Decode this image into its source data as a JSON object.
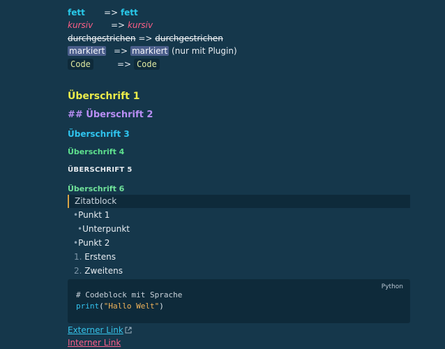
{
  "formatting": {
    "bold": {
      "source": "fett",
      "arrow": "=>",
      "result": "fett"
    },
    "italic": {
      "source": "kursiv",
      "arrow": "=>",
      "result": "kursiv"
    },
    "strike": {
      "source": "durchgestrichen",
      "arrow": "=>",
      "result": "durchgestrichen"
    },
    "mark": {
      "source": "markiert",
      "arrow": "=>",
      "result": "markiert",
      "note": "(nur mit Plugin)"
    },
    "code": {
      "source": "Code",
      "arrow": "=>",
      "result": "Code"
    }
  },
  "headings": {
    "h1": "Überschrift 1",
    "h2": "## Überschrift 2",
    "h3": "Überschrift 3",
    "h4": "Überschrift 4",
    "h5": "Überschrift 5",
    "h6": "Überschrift 6"
  },
  "quote": "Zitatblock",
  "bullets": {
    "item1": "Punkt 1",
    "sub1": "Unterpunkt",
    "item2": "Punkt 2",
    "marker": "•"
  },
  "ordered": {
    "n1": "1.",
    "item1": "Erstens",
    "n2": "2.",
    "item2": "Zweitens"
  },
  "codeblock": {
    "language": "Python",
    "line1": "# Codeblock mit Sprache",
    "fn": "print",
    "open": "(",
    "string": "\"Hallo Welt\"",
    "close": ")"
  },
  "links": {
    "external": "Externer Link",
    "internal": "Interner Link"
  },
  "colors": {
    "background": "#15374b",
    "bold": "#29c9ea",
    "italic": "#ff5f87",
    "h1": "#ecec4a",
    "h2": "#b98ef5",
    "quote_border": "#d8a346"
  }
}
